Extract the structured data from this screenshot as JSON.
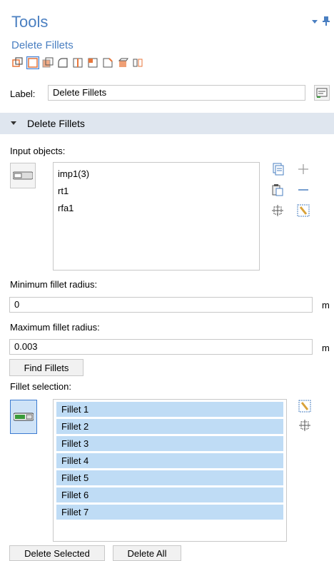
{
  "panel": {
    "title": "Tools",
    "subtitle": "Delete Fillets"
  },
  "label_row": {
    "label": "Label:",
    "value": "Delete Fillets"
  },
  "section": {
    "title": "Delete Fillets"
  },
  "input_objects": {
    "label": "Input objects:",
    "items": [
      "imp1(3)",
      "rt1",
      "rfa1"
    ]
  },
  "min_radius": {
    "label": "Minimum fillet radius:",
    "value": "0",
    "unit": "m"
  },
  "max_radius": {
    "label": "Maximum fillet radius:",
    "value": "0.003",
    "unit": "m"
  },
  "find_button": "Find Fillets",
  "fillet_selection": {
    "label": "Fillet selection:",
    "items": [
      "Fillet 1",
      "Fillet 2",
      "Fillet 3",
      "Fillet 4",
      "Fillet 5",
      "Fillet 6",
      "Fillet 7"
    ]
  },
  "buttons": {
    "delete_selected": "Delete Selected",
    "delete_all": "Delete All"
  },
  "colors": {
    "accent": "#4a7fc1",
    "section_bg": "#dfe6ef",
    "selection": "#bfdcf5",
    "toolbar_orange": "#e8763a"
  }
}
